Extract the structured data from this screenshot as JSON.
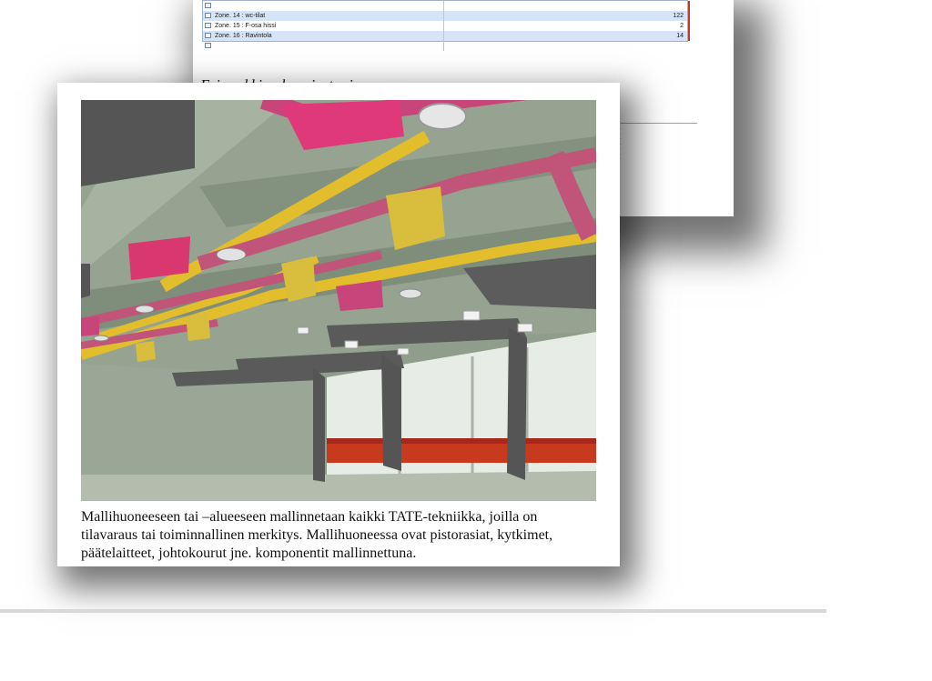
{
  "zone_table": {
    "rows": [
      {
        "name": "",
        "value": ""
      },
      {
        "name": "Zone. 14 : wc-tilat",
        "value": "122"
      },
      {
        "name": "Zone. 15 : F-osa hissi",
        "value": "2"
      },
      {
        "name": "Zone. 16 : Ravintola",
        "value": "14"
      },
      {
        "name": "",
        "value": ""
      }
    ]
  },
  "back_caption": "Esimerkki ... kaaviosta, jossa",
  "legend_lines": [
    "...",
    "...",
    "...",
    "...",
    "...",
    "...",
    "..."
  ],
  "caption_lines": [
    "Mallihuoneeseen tai –alueeseen mallinnetaan kaikki TATE-tekniikka, joilla on",
    "tilavaraus tai toiminnallinen merkitys. Mallihuoneessa ovat pistorasiat, kytkimet,",
    "päätelaitteet, johtokourut jne. komponentit mallinnettuna."
  ],
  "colors": {
    "duct_magenta": "#c8457a",
    "pipe_yellow": "#e8c12a",
    "beam_dark": "#555555",
    "ceiling_green": "#8b9a87",
    "floor_green": "#b7c0b0",
    "radiator_red": "#c83a1e",
    "table_highlight": "#d6e4f7"
  }
}
